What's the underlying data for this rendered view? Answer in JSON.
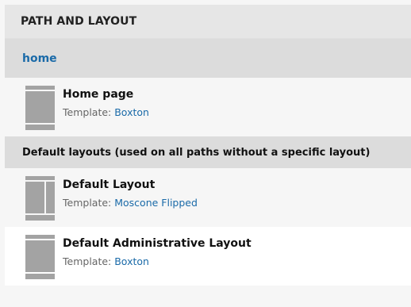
{
  "header": {
    "title": "PATH AND LAYOUT"
  },
  "path": {
    "label": "home"
  },
  "home_item": {
    "name": "Home page",
    "template_prefix": "Template:",
    "template_name": "Boxton"
  },
  "default_section": {
    "title": "Default layouts (used on all paths without a specific layout)"
  },
  "default_items": [
    {
      "name": "Default Layout",
      "template_prefix": "Template:",
      "template_name": "Moscone Flipped"
    },
    {
      "name": "Default Administrative Layout",
      "template_prefix": "Template:",
      "template_name": "Boxton"
    }
  ],
  "colors": {
    "link": "#1a6aa8",
    "icon_fill": "#a3a3a3",
    "header_bg": "#e6e6e6",
    "section_bg": "#dcdcdc"
  }
}
